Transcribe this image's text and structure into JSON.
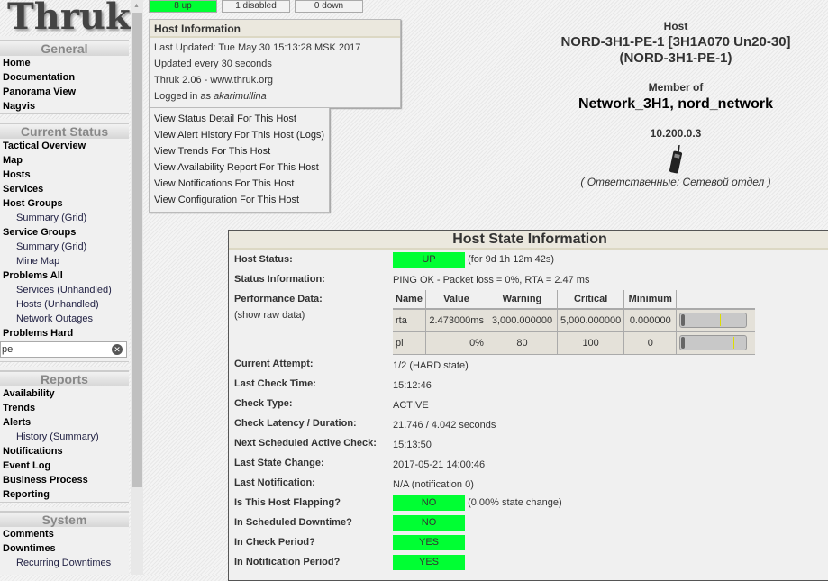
{
  "sidebar": {
    "logo": "Thruk",
    "sections": [
      {
        "title": "General",
        "items": [
          {
            "label": "Home"
          },
          {
            "label": "Documentation"
          },
          {
            "label": "Panorama View"
          },
          {
            "label": "Nagvis"
          }
        ]
      },
      {
        "title": "Current Status",
        "items": [
          {
            "label": "Tactical Overview"
          },
          {
            "label": "Map"
          },
          {
            "label": "Hosts"
          },
          {
            "label": "Services"
          },
          {
            "label": "Host Groups"
          },
          {
            "label": "Summary (Grid)",
            "sub": true
          },
          {
            "label": "Service Groups"
          },
          {
            "label": "Summary (Grid)",
            "sub": true
          },
          {
            "label": "Mine Map",
            "sub": true
          },
          {
            "label": "Problems All"
          },
          {
            "label": "Services (Unhandled)",
            "sub": true
          },
          {
            "label": "Hosts (Unhandled)",
            "sub": true
          },
          {
            "label": "Network Outages",
            "sub": true
          },
          {
            "label": "Problems Hard"
          }
        ]
      },
      {
        "title": "Reports",
        "items": [
          {
            "label": "Availability"
          },
          {
            "label": "Trends"
          },
          {
            "label": "Alerts"
          },
          {
            "label": "History (Summary)",
            "sub": true
          },
          {
            "label": "Notifications"
          },
          {
            "label": "Event Log"
          },
          {
            "label": "Business Process"
          },
          {
            "label": "Reporting"
          }
        ]
      },
      {
        "title": "System",
        "items": [
          {
            "label": "Comments"
          },
          {
            "label": "Downtimes"
          },
          {
            "label": "Recurring Downtimes",
            "sub": true
          }
        ]
      }
    ],
    "search_value": "pe"
  },
  "status_totals": {
    "up": "8 up",
    "disabled": "1 disabled",
    "down": "0 down",
    "up_color": "#00ff33"
  },
  "host_information": {
    "title": "Host Information",
    "last_updated": "Last Updated: Tue May 30 15:13:28 MSK 2017",
    "update_interval": "Updated every 30 seconds",
    "version": "Thruk 2.06 - www.thruk.org",
    "logged_in_prefix": "Logged in as ",
    "user": "akarimullina"
  },
  "links": [
    "View Status Detail For This Host",
    "View Alert History For This Host (Logs)",
    "View Trends For This Host",
    "View Availability Report For This Host",
    "View Notifications For This Host",
    "View Configuration For This Host"
  ],
  "host": {
    "label": "Host",
    "name": "NORD-3H1-PE-1 [3H1A070 Un20-30]",
    "alias": "(NORD-3H1-PE-1)",
    "member_label": "Member of",
    "groups": "Network_3H1, nord_network",
    "address": "10.200.0.3",
    "icon": "cellphone-icon",
    "note": "( Ответственные: Сетевой отдел )"
  },
  "state": {
    "title": "Host State Information",
    "host_status_label": "Host Status:",
    "host_status": "UP",
    "host_status_duration": "(for 9d 1h 12m 42s)",
    "status_info_label": "Status Information:",
    "status_info": "PING OK - Packet loss = 0%, RTA = 2.47 ms",
    "perf_label": "Performance Data:",
    "show_raw": "(show raw data)",
    "perf_headers": [
      "Name",
      "Value",
      "Warning",
      "Critical",
      "Minimum"
    ],
    "perf_rows": [
      {
        "name": "rta",
        "value": "2.473000ms",
        "warning": "3,000.000000",
        "critical": "5,000.000000",
        "minimum": "0.000000",
        "warn_fraction": 0.6
      },
      {
        "name": "pl",
        "value": "0%",
        "warning": "80",
        "critical": "100",
        "minimum": "0",
        "warn_fraction": 0.8
      }
    ],
    "rows": [
      {
        "label": "Current Attempt:",
        "value": "1/2  (HARD state)"
      },
      {
        "label": "Last Check Time:",
        "value": "15:12:46"
      },
      {
        "label": "Check Type:",
        "value": "ACTIVE"
      },
      {
        "label": "Check Latency / Duration:",
        "value": "21.746  /  4.042 seconds"
      },
      {
        "label": "Next Scheduled Active Check:",
        "value": "15:13:50"
      },
      {
        "label": "Last State Change:",
        "value": "2017-05-21 14:00:46"
      },
      {
        "label": "Last Notification:",
        "value": "N/A  (notification 0)"
      }
    ],
    "flags": [
      {
        "label": "Is This Host Flapping?",
        "value": "NO",
        "extra": "(0.00% state change)"
      },
      {
        "label": "In Scheduled Downtime?",
        "value": "NO",
        "extra": ""
      },
      {
        "label": "In Check Period?",
        "value": "YES",
        "extra": ""
      },
      {
        "label": "In Notification Period?",
        "value": "YES",
        "extra": ""
      }
    ]
  }
}
